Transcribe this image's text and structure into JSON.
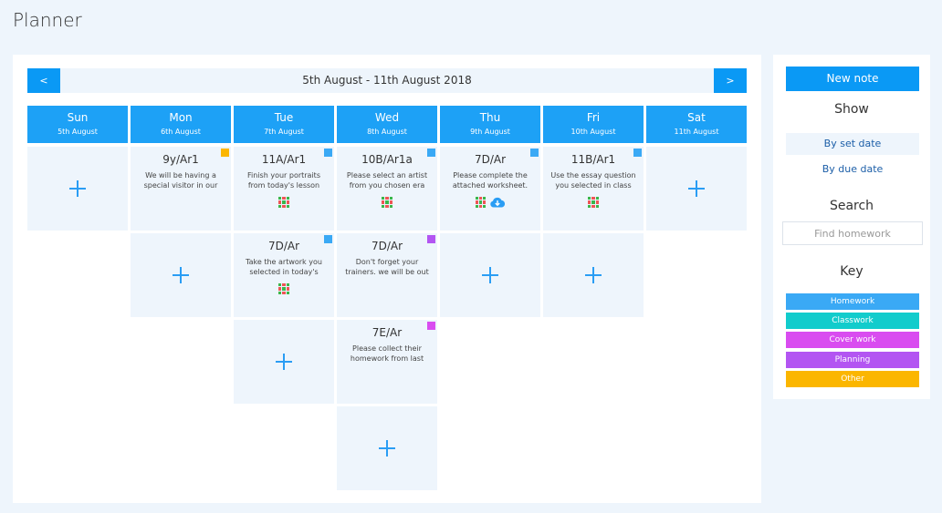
{
  "page": {
    "title": "Planner"
  },
  "week": {
    "range": "5th August - 11th August 2018",
    "prev_label": "<",
    "next_label": ">"
  },
  "days": [
    {
      "name": "Sun",
      "date": "5th August"
    },
    {
      "name": "Mon",
      "date": "6th August"
    },
    {
      "name": "Tue",
      "date": "7th August"
    },
    {
      "name": "Wed",
      "date": "8th August"
    },
    {
      "name": "Thu",
      "date": "9th August"
    },
    {
      "name": "Fri",
      "date": "10th August"
    },
    {
      "name": "Sat",
      "date": "11th August"
    }
  ],
  "notes": {
    "mon_1": {
      "title": "9y/Ar1",
      "text": "We will be having a special visitor in our class",
      "type": "other",
      "icons": []
    },
    "tue_1": {
      "title": "11A/Ar1",
      "text": "Finish your portraits from today's lesson along with",
      "type": "homework",
      "icons": [
        "grid-icon"
      ]
    },
    "tue_2": {
      "title": "7D/Ar",
      "text": "Take the artwork you selected in today's lesson",
      "type": "homework",
      "icons": [
        "grid-icon"
      ]
    },
    "wed_1": {
      "title": "10B/Ar1a",
      "text": "Please select an artist from you chosen era",
      "type": "homework",
      "icons": [
        "grid-icon"
      ]
    },
    "wed_2": {
      "title": "7D/Ar",
      "text": "Don't forget your trainers. we will be out of the",
      "type": "planning",
      "icons": []
    },
    "wed_3": {
      "title": "7E/Ar",
      "text": "Please collect their homework from last week",
      "type": "cover",
      "icons": []
    },
    "thu_1": {
      "title": "7D/Ar",
      "text": "Please complete the attached worksheet.",
      "type": "homework",
      "icons": [
        "grid-icon",
        "cloud-download-icon"
      ]
    },
    "fri_1": {
      "title": "11B/Ar1",
      "text": "Use the essay question you selected in class and",
      "type": "homework",
      "icons": [
        "grid-icon"
      ]
    }
  },
  "sidebar": {
    "new_note_label": "New note",
    "show_heading": "Show",
    "filters": [
      {
        "label": "By set date",
        "active": true
      },
      {
        "label": "By due date",
        "active": false
      }
    ],
    "search_heading": "Search",
    "search_placeholder": "Find homework",
    "key_heading": "Key",
    "key": [
      {
        "label": "Homework",
        "color": "#3aa9f5"
      },
      {
        "label": "Classwork",
        "color": "#12cccc"
      },
      {
        "label": "Cover work",
        "color": "#d94cf0"
      },
      {
        "label": "Planning",
        "color": "#b355f2"
      },
      {
        "label": "Other",
        "color": "#fbb600"
      }
    ]
  },
  "colors": {
    "accent": "#0a99f5",
    "day_header": "#1da1f6",
    "cell_bg": "#eef5fc",
    "homework": "#3aa9f5",
    "cover": "#d94cf0",
    "planning": "#b355f2",
    "other": "#fbb600"
  }
}
